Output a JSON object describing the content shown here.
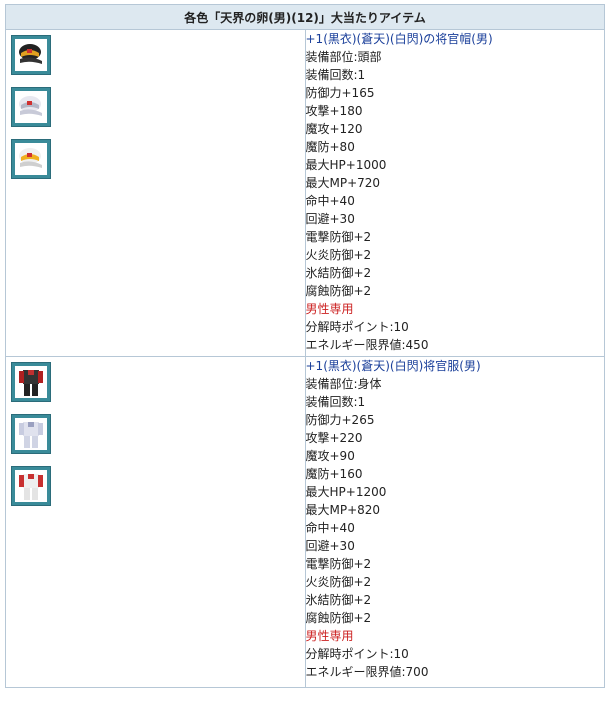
{
  "header": {
    "title": "各色「天界の卵(男)(12)」大当たりアイテム"
  },
  "items": [
    {
      "icons": [
        "black-cap-icon",
        "white-cap-icon",
        "yellow-cap-icon"
      ],
      "name": "+1(黒衣)(蒼天)(白閃)の将官帽(男)",
      "stats": [
        "装備部位:頭部",
        "装備回数:1",
        "防御力+165",
        "攻撃+180",
        "魔攻+120",
        "魔防+80",
        "最大HP+1000",
        "最大MP+720",
        "命中+40",
        "回避+30",
        "電撃防御+2",
        "火炎防御+2",
        "氷結防御+2",
        "腐蝕防御+2"
      ],
      "restriction": "男性専用",
      "extra": [
        "分解時ポイント:10",
        "エネルギー限界値:450"
      ]
    },
    {
      "icons": [
        "black-uniform-icon",
        "white-uniform-icon",
        "red-white-uniform-icon"
      ],
      "name": "+1(黒衣)(蒼天)(白閃)将官服(男)",
      "stats": [
        "装備部位:身体",
        "装備回数:1",
        "防御力+265",
        "攻撃+220",
        "魔攻+90",
        "魔防+160",
        "最大HP+1200",
        "最大MP+820",
        "命中+40",
        "回避+30",
        "電撃防御+2",
        "火炎防御+2",
        "氷結防御+2",
        "腐蝕防御+2"
      ],
      "restriction": "男性専用",
      "extra": [
        "分解時ポイント:10",
        "エネルギー限界値:700"
      ]
    }
  ]
}
